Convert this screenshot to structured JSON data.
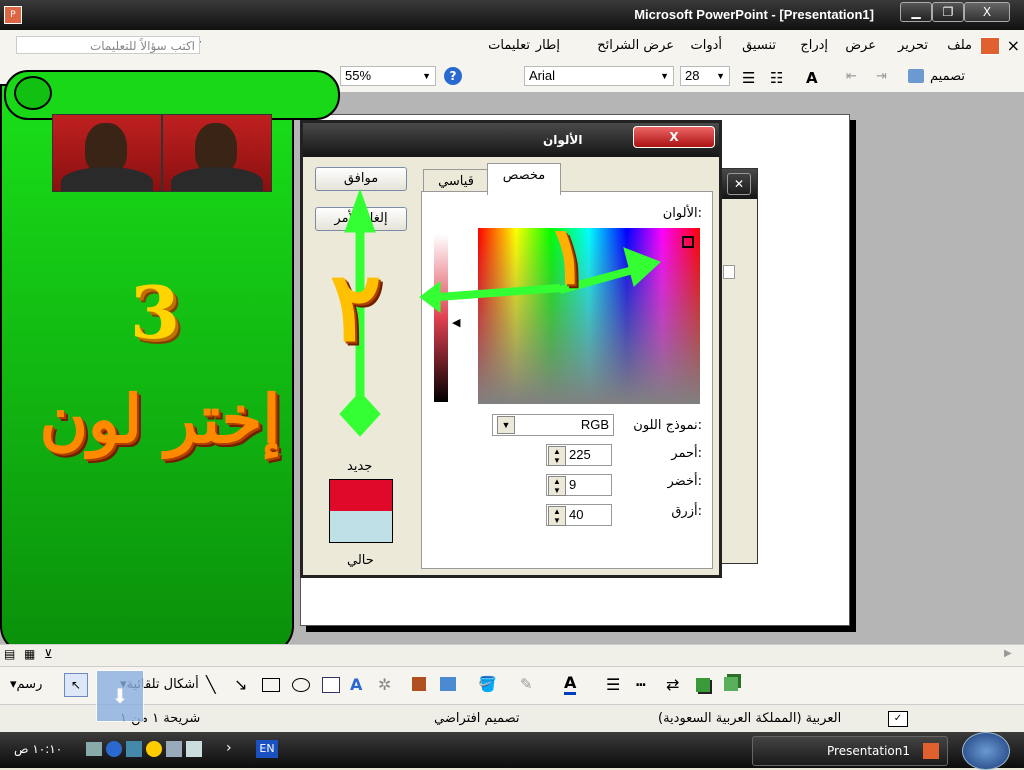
{
  "window": {
    "title": "Microsoft PowerPoint - [Presentation1]",
    "minimize": "▁",
    "restore": "❐",
    "close": "X"
  },
  "menubar": {
    "items": [
      "ملف",
      "تحرير",
      "عرض",
      "إدراج",
      "تنسيق",
      "أدوات",
      "عرض الشرائح",
      "إطار",
      "تعليمات"
    ],
    "close_glyph": "×",
    "ask_placeholder": "اكتب سؤالاً للتعليمات"
  },
  "toolbar": {
    "zoom": "55%",
    "font": "Arial",
    "size": "28",
    "design_label": "تصميم",
    "font_grow": "A"
  },
  "dialog": {
    "title": "الألوان",
    "close": "X",
    "ok": "موافق",
    "cancel": "إلغاء الأمر",
    "tab_standard": "قياسي",
    "tab_custom": "مخصص",
    "colors_label": "الألوان:",
    "model_label": "نموذج اللون:",
    "model_value": "RGB",
    "red_label": "أحمر:",
    "green_label": "أخضر:",
    "blue_label": "أزرق:",
    "red_value": "225",
    "green_value": "9",
    "blue_value": "40",
    "new_label": "جديد",
    "current_label": "حالي",
    "new_color": "#e1092a",
    "current_color": "#c0e0e8"
  },
  "overlay": {
    "step_number": "3",
    "instruction": "إختر لون",
    "marker_1": "١",
    "marker_2": "٢"
  },
  "drawbar": {
    "draw_label": "رسم",
    "autoshapes_label": "أشكال تلقائية"
  },
  "statusbar": {
    "slide": "شريحة ١ من ١",
    "design": "تصميم افتراضي",
    "language": "العربية (المملكة العربية السعودية)"
  },
  "taskbar": {
    "clock": "١٠:١٠ ص",
    "lang": "EN",
    "task": "Presentation1"
  },
  "colors": {
    "green_banner": "#12c012",
    "arrow": "#33ff33",
    "accent_orange": "#ff8a00"
  }
}
